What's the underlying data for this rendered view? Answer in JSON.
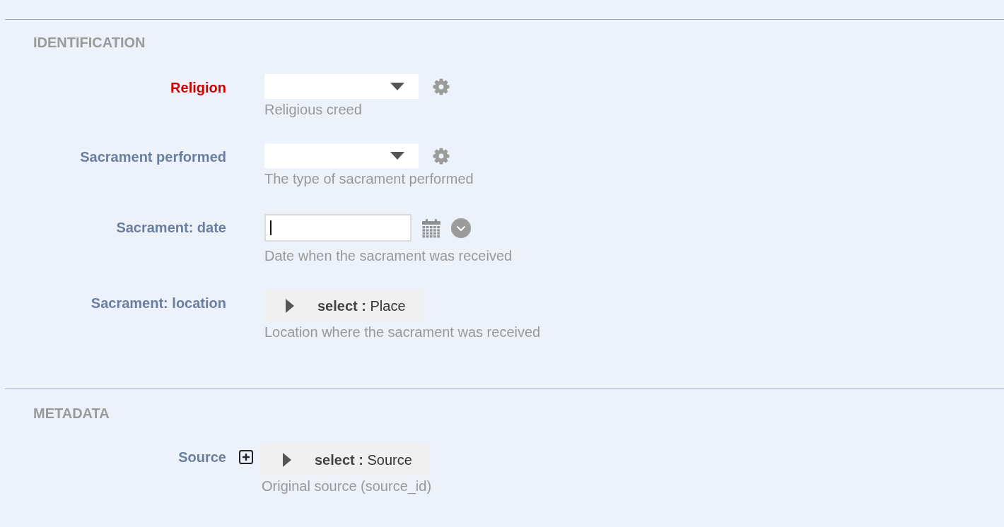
{
  "sections": [
    {
      "title": "IDENTIFICATION",
      "fields": [
        {
          "kind": "select",
          "label": "Religion",
          "required": true,
          "add_button": false,
          "help": "Religious creed"
        },
        {
          "kind": "select",
          "label": "Sacrament performed",
          "required": false,
          "add_button": false,
          "help": "The type of sacrament performed"
        },
        {
          "kind": "date",
          "label": "Sacrament: date",
          "required": false,
          "add_button": false,
          "focused": true,
          "help": "Date when the sacrament was received"
        },
        {
          "kind": "lookup",
          "label": "Sacrament: location",
          "required": false,
          "add_button": false,
          "text": "**select :** Place",
          "help": "Location where the sacrament was received"
        }
      ]
    },
    {
      "title": "METADATA",
      "fields": [
        {
          "kind": "lookup",
          "label": "Source",
          "required": false,
          "add_button": true,
          "text": "**select :** Source",
          "help": "Original source (source_id)"
        }
      ]
    }
  ]
}
